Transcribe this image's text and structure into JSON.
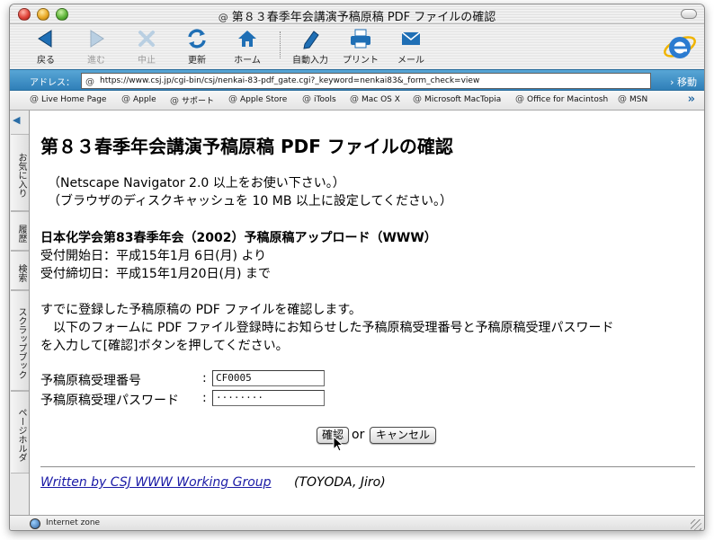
{
  "window": {
    "title": "第８３春季年会講演予稿原稿 PDF ファイルの確認"
  },
  "toolbar": {
    "back": "戻る",
    "forward": "進む",
    "stop": "中止",
    "refresh": "更新",
    "home": "ホーム",
    "autofill": "自動入力",
    "print": "プリント",
    "mail": "メール"
  },
  "address": {
    "label": "アドレス：",
    "url": "https://www.csj.jp/cgi-bin/csj/nenkai-83-pdf_gate.cgi?_keyword=nenkai83&_form_check=view",
    "go": "移動"
  },
  "favorites": [
    "Live Home Page",
    "Apple",
    "サポート",
    "Apple Store",
    "iTools",
    "Mac OS X",
    "Microsoft MacTopia",
    "Office for Macintosh",
    "MSN"
  ],
  "side_tabs": [
    "お気に入り",
    "履歴",
    "検索",
    "スクラップブック",
    "ページホルダ"
  ],
  "page": {
    "heading": "第８３春季年会講演予稿原稿 PDF ファイルの確認",
    "note1": "（Netscape Navigator 2.0 以上をお使い下さい。）",
    "note2": "（ブラウザのディスクキャッシュを 10 MB 以上に設定してください。）",
    "event_title": "日本化学会第83春季年会（2002）予稿原稿アップロード（WWW）",
    "start": "受付開始日：平成15年1月 6日(月) より",
    "end": "受付締切日：平成15年1月20日(月) まで",
    "intro1": "すでに登録した予稿原稿の PDF ファイルを確認します。",
    "intro2": "　以下のフォームに PDF ファイル登録時にお知らせした予稿原稿受理番号と予稿原稿受理パスワード",
    "intro3": "を入力して[確認]ボタンを押してください。",
    "id_label": "予稿原稿受理番号",
    "pw_label": "予稿原稿受理パスワード",
    "colon": ":",
    "id_value": "CF0005",
    "pw_value": "········",
    "confirm": "確認",
    "or": "or",
    "cancel": "キャンセル",
    "footer_link": "Written by CSJ WWW Working Group",
    "footer_tail": "(TOYODA, Jiro)"
  },
  "status": {
    "zone": "Internet zone"
  },
  "colors": {
    "address_bar": "#2f7fb8",
    "link": "#1a1aa6"
  }
}
